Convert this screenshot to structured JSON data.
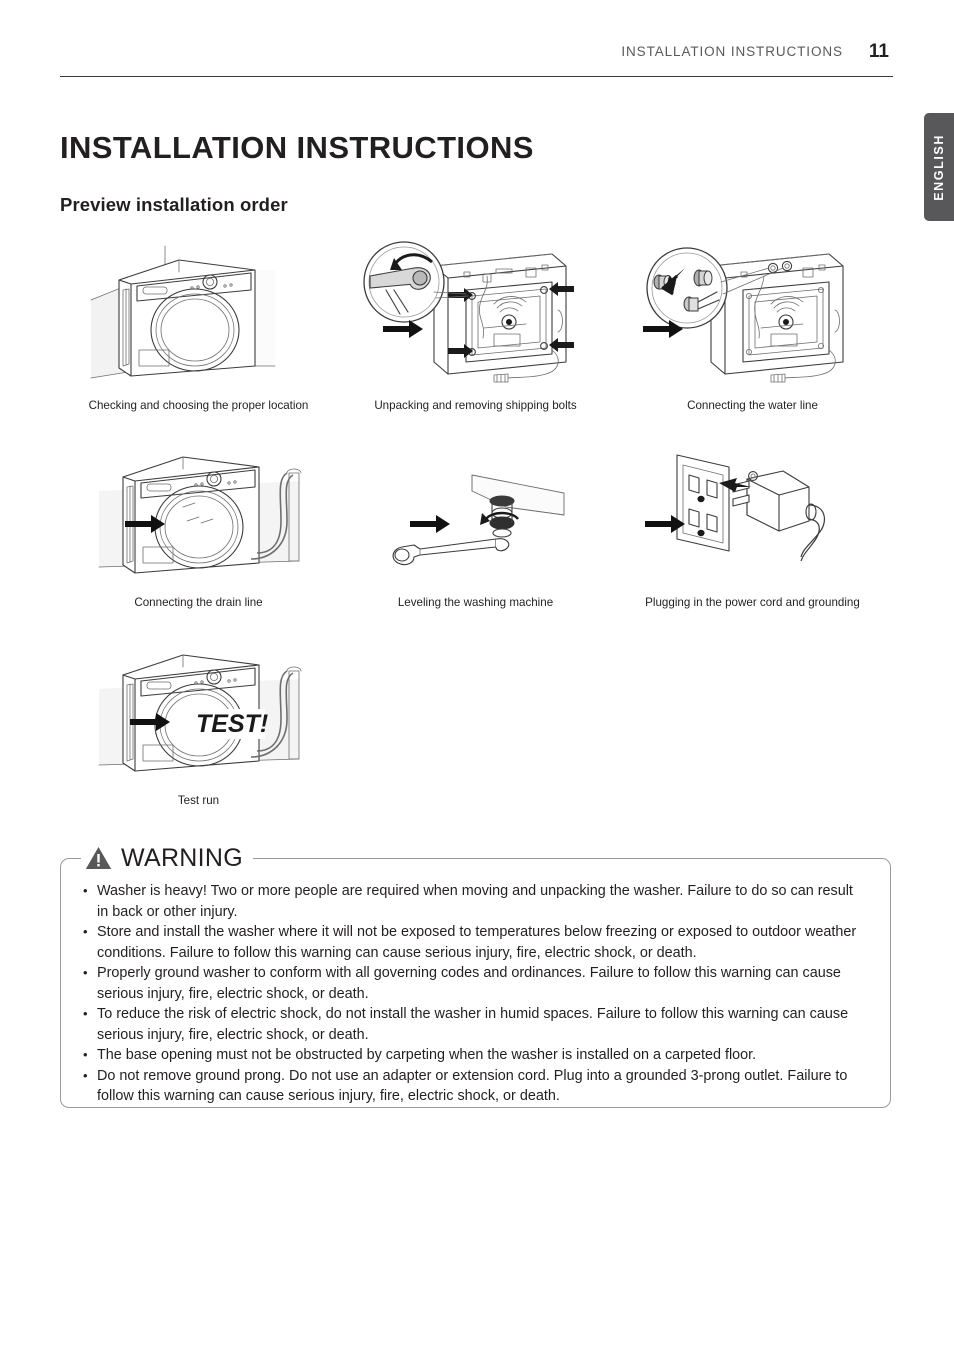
{
  "header": {
    "title": "INSTALLATION INSTRUCTIONS",
    "page_number": "11"
  },
  "language_tab": {
    "label": "ENGLISH"
  },
  "chapter_title": "INSTALLATION INSTRUCTIONS",
  "section_title": "Preview installation order",
  "flow": {
    "steps": [
      {
        "caption": "Checking and choosing the proper location",
        "icon": "washer-front-in-corner-illustration"
      },
      {
        "caption": "Unpacking and removing shipping bolts",
        "icon": "washer-back-shipping-bolts-wrench-illustration"
      },
      {
        "caption": "Connecting the water line",
        "icon": "washer-back-water-inlet-hose-illustration"
      },
      {
        "caption": "Connecting the drain line",
        "icon": "washer-front-drain-hose-illustration"
      },
      {
        "caption": "Leveling the washing machine",
        "icon": "leveling-foot-wrench-illustration"
      },
      {
        "caption": "Plugging in the power cord and grounding",
        "icon": "power-outlet-plug-illustration"
      },
      {
        "caption": "Test run",
        "icon": "washer-test-run-illustration"
      }
    ],
    "test_badge": "TEST!",
    "arrow_icon": "right-arrow-icon"
  },
  "warning": {
    "label": "WARNING",
    "icon": "warning-triangle-icon",
    "items": [
      "Washer is heavy! Two or more people are required when moving and unpacking the washer. Failure to do so can result in back or other injury.",
      "Store and install the washer where it will not be exposed to temperatures below freezing or exposed to outdoor weather conditions. Failure to follow this warning can cause serious injury, fire, electric shock, or death.",
      "Properly ground washer to conform with all governing codes and ordinances. Failure to follow this warning can cause serious injury, fire, electric shock, or death.",
      "To reduce the risk of electric shock, do not install the washer in humid spaces. Failure to follow this warning can cause serious injury, fire, electric shock, or death.",
      "The base opening must not be obstructed by carpeting when the washer is installed on a carpeted floor.",
      "Do not remove ground prong. Do not use an adapter or extension cord. Plug into a grounded 3-prong outlet. Failure to follow this warning can cause serious injury, fire, electric shock, or death."
    ]
  },
  "colors": {
    "text": "#231f20",
    "header_text": "#58595b",
    "tab_background": "#58585a",
    "warning_border": "#9b9b9b",
    "line_art": "#3c3c3c"
  }
}
